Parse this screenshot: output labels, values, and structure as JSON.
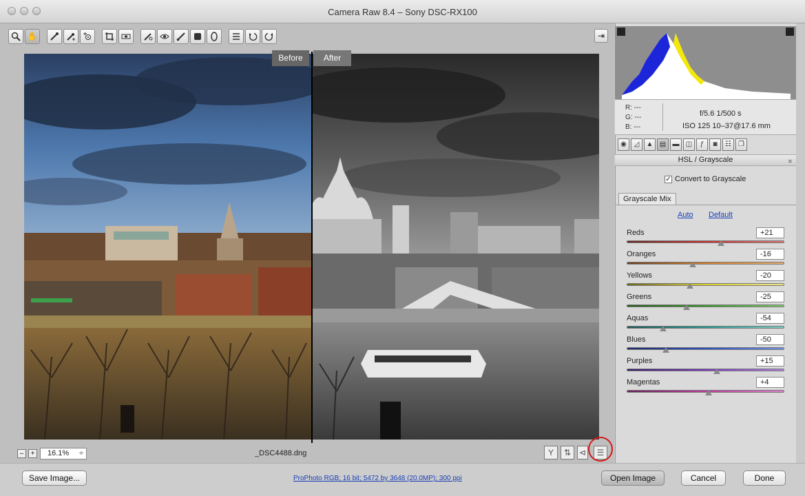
{
  "window": {
    "title": "Camera Raw 8.4  –  Sony DSC-RX100"
  },
  "toolbar": {
    "tools": [
      {
        "name": "zoom-tool",
        "icon": "magnifier-icon"
      },
      {
        "name": "hand-tool",
        "icon": "hand-icon"
      },
      {
        "name": "white-balance-tool",
        "icon": "eyedropper-icon"
      },
      {
        "name": "color-sampler-tool",
        "icon": "eyedropper-plus-icon"
      },
      {
        "name": "targeted-adjustment-tool",
        "icon": "target-icon"
      },
      {
        "name": "crop-tool",
        "icon": "crop-icon"
      },
      {
        "name": "straighten-tool",
        "icon": "level-icon"
      },
      {
        "name": "spot-removal-tool",
        "icon": "brush-heal-icon"
      },
      {
        "name": "red-eye-tool",
        "icon": "eye-icon"
      },
      {
        "name": "adjustment-brush-tool",
        "icon": "brush-icon"
      },
      {
        "name": "graduated-filter-tool",
        "icon": "gradient-icon"
      },
      {
        "name": "radial-filter-tool",
        "icon": "ellipse-icon"
      },
      {
        "name": "preferences-button",
        "icon": "list-icon"
      },
      {
        "name": "rotate-ccw-button",
        "icon": "rotate-left-icon"
      },
      {
        "name": "rotate-cw-button",
        "icon": "rotate-right-icon"
      }
    ]
  },
  "preview": {
    "before_label": "Before",
    "after_label": "After",
    "filename": "_DSC4488.dng"
  },
  "zoom": {
    "value": "16.1%",
    "minus": "–",
    "plus": "+",
    "stepper": "÷"
  },
  "histogram": {
    "rgb": {
      "r": "R:  ---",
      "g": "G:  ---",
      "b": "B:  ---"
    },
    "exif": {
      "aperture_shutter": "f/5.6   1/500 s",
      "iso_lens": "ISO 125   10–37@17.6 mm"
    }
  },
  "panel": {
    "title": "HSL / Grayscale",
    "convert_label": "Convert to Grayscale",
    "convert_checked": "✓",
    "subtab": "Grayscale Mix",
    "auto": "Auto",
    "default": "Default",
    "sliders": [
      {
        "label": "Reds",
        "value": "+21",
        "pos": 0.6,
        "gradient": "linear-gradient(90deg,#6b2525,#c33,#d77)"
      },
      {
        "label": "Oranges",
        "value": "-16",
        "pos": 0.42,
        "gradient": "linear-gradient(90deg,#6b4020,#d8802a,#e9b170)"
      },
      {
        "label": "Yellows",
        "value": "-20",
        "pos": 0.4,
        "gradient": "linear-gradient(90deg,#6b6520,#d9cf30,#ebe580)"
      },
      {
        "label": "Greens",
        "value": "-25",
        "pos": 0.38,
        "gradient": "linear-gradient(90deg,#2a5a20,#3a9a2a,#80c870)"
      },
      {
        "label": "Aquas",
        "value": "-54",
        "pos": 0.23,
        "gradient": "linear-gradient(90deg,#1e5a5a,#2a9a90,#80cfc8)"
      },
      {
        "label": "Blues",
        "value": "-50",
        "pos": 0.25,
        "gradient": "linear-gradient(90deg,#1e2a6a,#2a50c0,#7090e0)"
      },
      {
        "label": "Purples",
        "value": "+15",
        "pos": 0.57,
        "gradient": "linear-gradient(90deg,#3a1e6a,#7a3ac0,#b080e0)"
      },
      {
        "label": "Magentas",
        "value": "+4",
        "pos": 0.52,
        "gradient": "linear-gradient(90deg,#6a1e5a,#c03aa0,#e080cf)"
      }
    ]
  },
  "footer": {
    "save": "Save Image...",
    "info": "ProPhoto RGB; 16 bit; 5472 by 3648 (20.0MP); 300 ppi",
    "open": "Open Image",
    "cancel": "Cancel",
    "done": "Done"
  }
}
